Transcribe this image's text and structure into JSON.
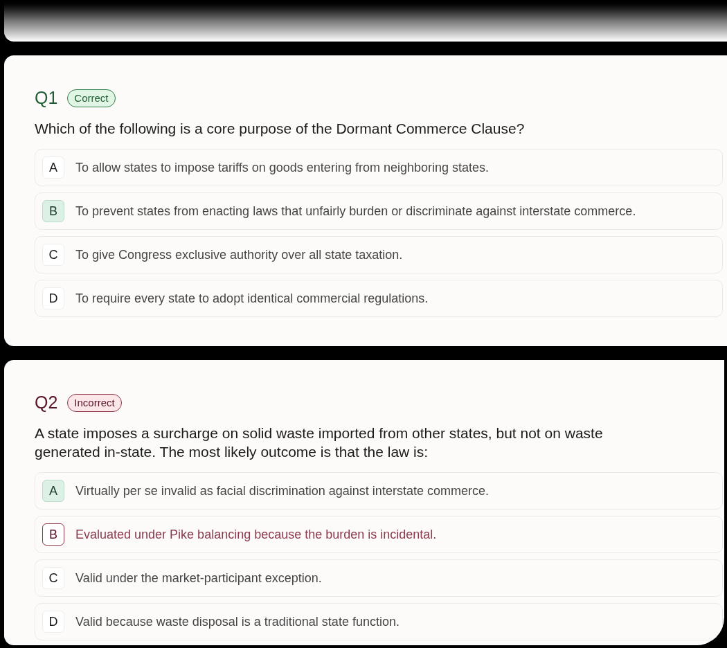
{
  "questions": [
    {
      "number": "Q1",
      "status": {
        "kind": "correct",
        "label": "Correct"
      },
      "prompt": "Which of the following is a core purpose of the Dormant Commerce Clause?",
      "options": [
        {
          "letter": "A",
          "text": "To allow states to impose tariffs on goods entering from neighboring states.",
          "correct": false,
          "wrong": false
        },
        {
          "letter": "B",
          "text": "To prevent states from enacting laws that unfairly burden or discriminate against interstate commerce.",
          "correct": true,
          "wrong": false
        },
        {
          "letter": "C",
          "text": "To give Congress exclusive authority over all state taxation.",
          "correct": false,
          "wrong": false
        },
        {
          "letter": "D",
          "text": "To require every state to adopt identical commercial regulations.",
          "correct": false,
          "wrong": false
        }
      ]
    },
    {
      "number": "Q2",
      "status": {
        "kind": "incorrect",
        "label": "Incorrect"
      },
      "prompt": "A state imposes a surcharge on solid waste imported from other states, but not on waste generated in-state. The most likely outcome is that the law is:",
      "options": [
        {
          "letter": "A",
          "text": "Virtually per se invalid as facial discrimination against interstate commerce.",
          "correct": true,
          "wrong": false
        },
        {
          "letter": "B",
          "text": "Evaluated under Pike balancing because the burden is incidental.",
          "correct": false,
          "wrong": true
        },
        {
          "letter": "C",
          "text": "Valid under the market-participant exception.",
          "correct": false,
          "wrong": false
        },
        {
          "letter": "D",
          "text": "Valid because waste disposal is a traditional state function.",
          "correct": false,
          "wrong": false
        }
      ]
    }
  ]
}
